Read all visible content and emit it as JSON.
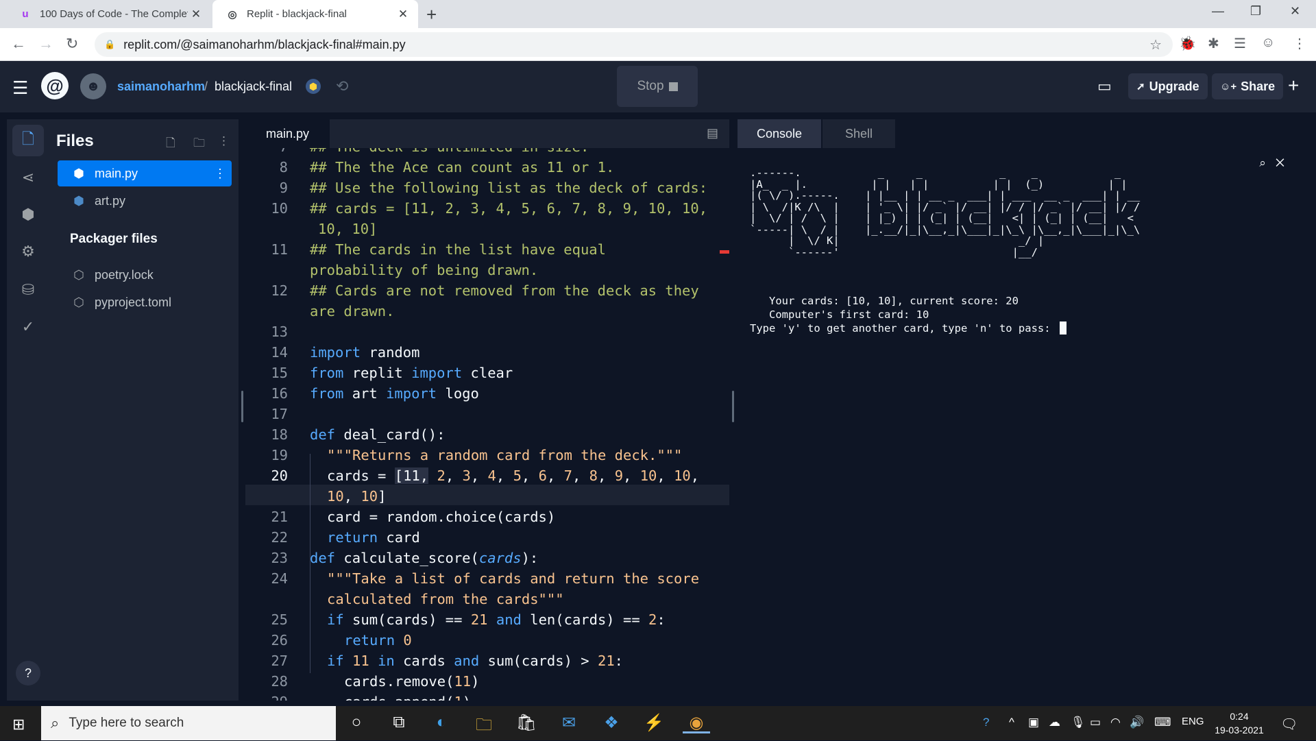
{
  "browser": {
    "tabs": [
      {
        "title": "100 Days of Code - The Complet",
        "favicon": "udemy-icon",
        "active": false
      },
      {
        "title": "Replit - blackjack-final",
        "favicon": "replit-icon",
        "active": true
      }
    ],
    "url": "replit.com/@saimanoharhm/blackjack-final#main.py"
  },
  "header": {
    "username": "saimanoharhm",
    "separator": "/",
    "repl_name": "blackjack-final",
    "stop_label": "Stop",
    "upgrade_label": "Upgrade",
    "share_label": "Share"
  },
  "files": {
    "title": "Files",
    "items": [
      {
        "name": "main.py",
        "active": true
      },
      {
        "name": "art.py",
        "active": false
      }
    ],
    "packager_title": "Packager files",
    "packager_items": [
      {
        "name": "poetry.lock"
      },
      {
        "name": "pyproject.toml"
      }
    ]
  },
  "editor": {
    "tab_label": "main.py",
    "current_line": "20"
  },
  "console": {
    "tabs": [
      "Console",
      "Shell"
    ],
    "active_tab": "Console",
    "ascii_art": ".------.            _     _            _    _            _    \n|A_  _ |.          | |   | |          | |  (_)          | |   \n|( \\/ ).-----.    | |__ | | __ _  ___| | ___  __ _  ___| | __\n| \\  /|K /\\  |    | '_ \\| |/ _` |/ __| |/ / |/ _` |/ __| |/ /\n|  \\/ | /  \\ |    | |_) | | (_| | (__|   <| | (_| | (__|   < \n`-----| \\  / |    |_.__/|_|\\__,_|\\___|_|\\_\\ |\\__,_|\\___|_|\\_\\\n      |  \\/ K|                            _/ |                \n      `------'                           |__/                 ",
    "lines": [
      "   Your cards: [10, 10], current score: 20",
      "   Computer's first card: 10",
      "Type 'y' to get another card, type 'n' to pass: "
    ]
  },
  "taskbar": {
    "search_placeholder": "Type here to search",
    "language": "ENG",
    "time": "0:24",
    "date": "19-03-2021"
  }
}
